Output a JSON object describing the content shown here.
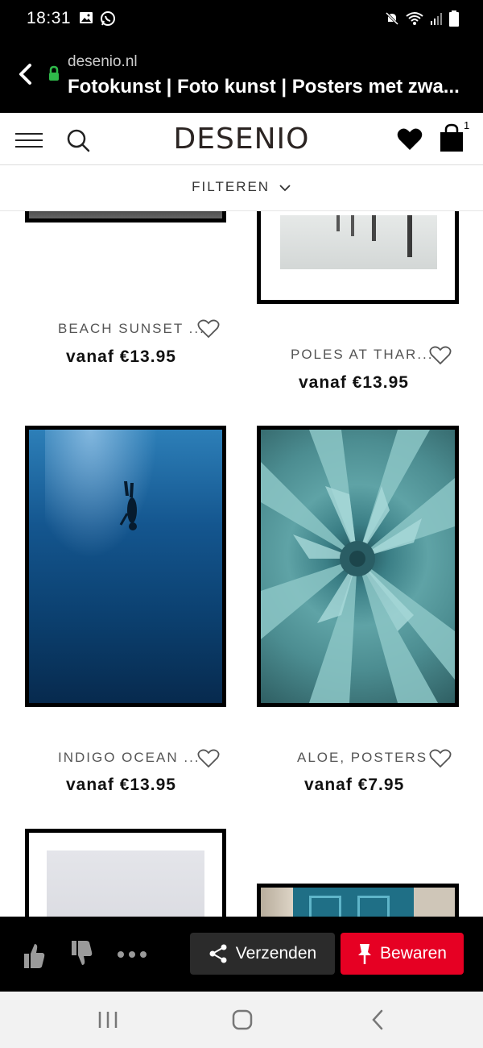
{
  "status_bar": {
    "time": "18:31",
    "left_icons": [
      "image-icon",
      "whatsapp-icon"
    ],
    "right_icons": [
      "mute-icon",
      "wifi-icon",
      "signal-icon",
      "battery-icon"
    ]
  },
  "browser": {
    "domain": "desenio.nl",
    "page_title": "Fotokunst | Foto kunst | Posters met zwa..."
  },
  "header": {
    "logo": "DESENIO",
    "cart_count": "1"
  },
  "filter": {
    "label": "FILTEREN"
  },
  "products": [
    {
      "title": "BEACH SUNSET ...",
      "price": "vanaf €13.95"
    },
    {
      "title": "POLES AT THAR...",
      "price": "vanaf €13.95"
    },
    {
      "title": "INDIGO OCEAN ...",
      "price": "vanaf €13.95"
    },
    {
      "title": "ALOE, POSTERS",
      "price": "vanaf €7.95"
    }
  ],
  "pin_bar": {
    "send_label": "Verzenden",
    "save_label": "Bewaren"
  },
  "colors": {
    "save_red": "#e60023",
    "send_grey": "#2b2b2b",
    "ocean_blue": "#0b3f6e",
    "aloe_teal": "#5fa3a6"
  }
}
